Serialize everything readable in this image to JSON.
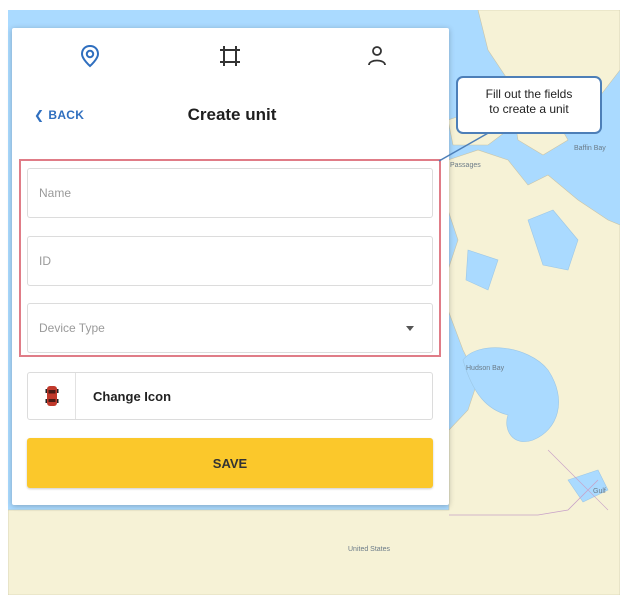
{
  "nav": {
    "icons": [
      "location-pin-icon",
      "crop-frame-icon",
      "user-icon"
    ],
    "active": "location-pin-icon",
    "accent": "#2f6fbf"
  },
  "header": {
    "back_label": "BACK",
    "title": "Create unit"
  },
  "form": {
    "name_placeholder": "Name",
    "id_placeholder": "ID",
    "device_type_placeholder": "Device Type",
    "change_icon_label": "Change Icon",
    "save_label": "SAVE"
  },
  "callout": {
    "line1": "Fill out the fields",
    "line2": "to create a unit"
  },
  "map": {
    "labels": [
      "Baffin Bay",
      "Hudson Bay",
      "United States",
      "Gulf",
      "Passages"
    ]
  },
  "colors": {
    "save_button": "#fbc82b",
    "highlight_border": "#e07c87",
    "callout_border": "#4d7fb8",
    "water": "#aadaff",
    "land": "#f6f2d6"
  }
}
